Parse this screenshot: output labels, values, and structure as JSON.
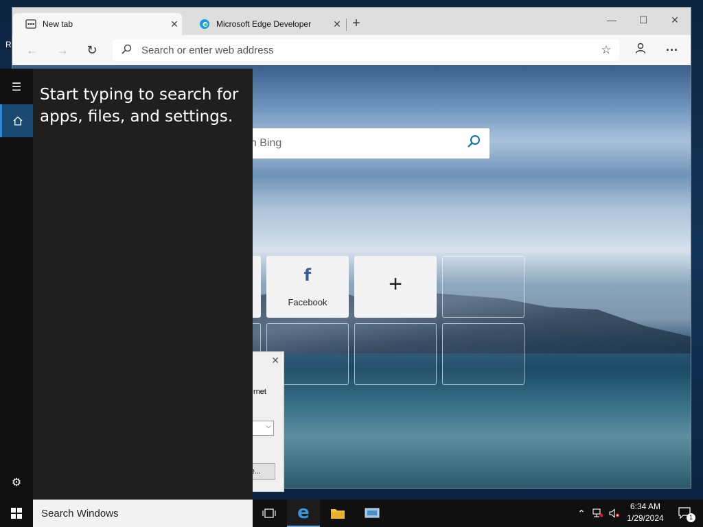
{
  "desktop": {
    "edge_text": "R"
  },
  "browser": {
    "tabs": [
      {
        "title": "New tab",
        "active": true
      },
      {
        "title": "Microsoft Edge Developer",
        "active": false
      }
    ],
    "new_tab_glyph": "+",
    "address_placeholder": "Search or enter web address",
    "search_box_text": "h with Bing",
    "tiles": [
      {
        "label": "Facebook",
        "glyph": "f"
      },
      {
        "glyph": "+"
      }
    ]
  },
  "dialog": {
    "text_fragment": "rnet",
    "button_fragment": "e..."
  },
  "start_menu": {
    "hint": "Start typing to search for apps, files, and settings."
  },
  "taskbar": {
    "search_placeholder": "Search Windows",
    "time": "6:34 AM",
    "date": "1/29/2024",
    "notification_count": "1"
  },
  "colors": {
    "accent": "#2b88d8",
    "start_bg": "#1f1f1f",
    "taskbar_bg": "#101010"
  }
}
